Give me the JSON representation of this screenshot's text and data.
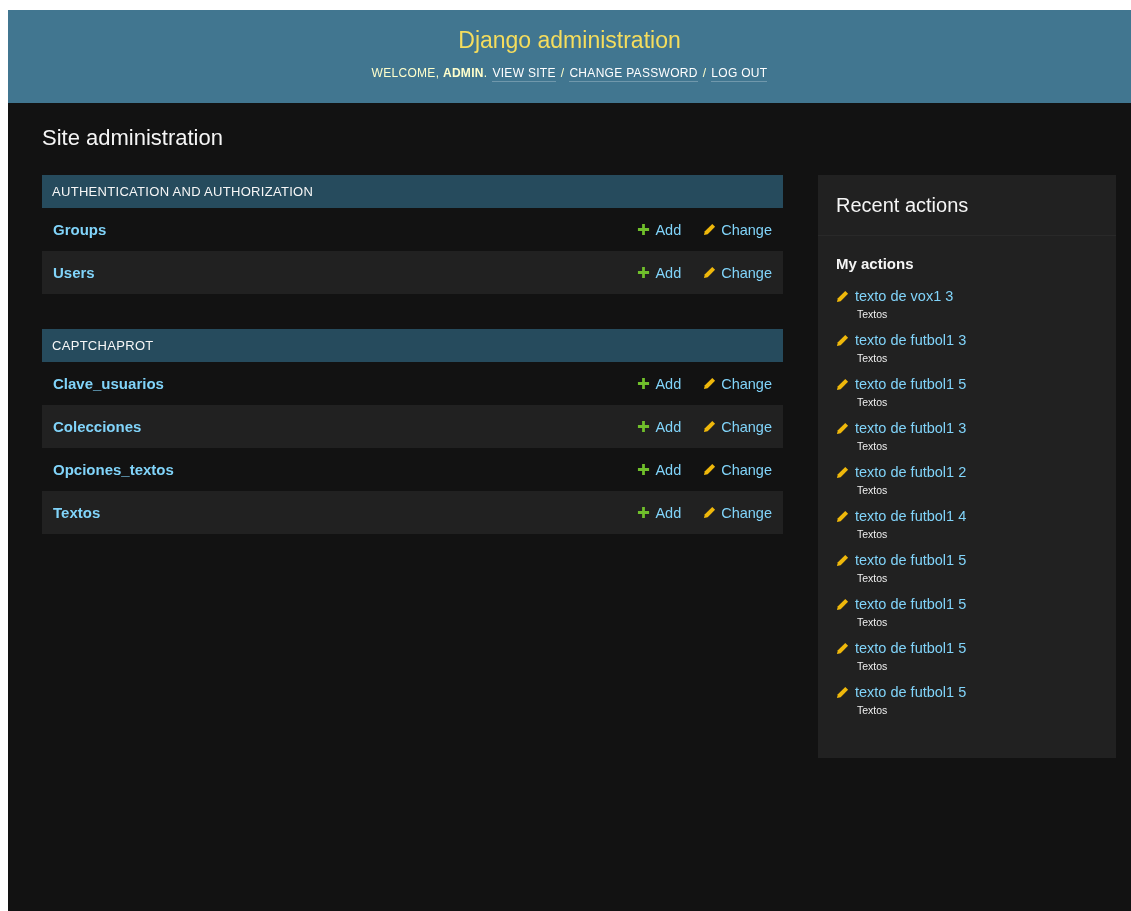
{
  "header": {
    "title": "Django administration",
    "welcome": "WELCOME, **ADMIN**.",
    "separator": "/",
    "links": [
      "VIEW SITE",
      "CHANGE PASSWORD",
      "LOG OUT"
    ]
  },
  "page_title": "Site administration",
  "modules": [
    {
      "caption": "AUTHENTICATION AND AUTHORIZATION",
      "rows": [
        {
          "name": "Groups",
          "add": "Add",
          "change": "Change"
        },
        {
          "name": "Users",
          "add": "Add",
          "change": "Change"
        }
      ]
    },
    {
      "caption": "CAPTCHAPROT",
      "rows": [
        {
          "name": "Clave_usuarios",
          "add": "Add",
          "change": "Change"
        },
        {
          "name": "Colecciones",
          "add": "Add",
          "change": "Change"
        },
        {
          "name": "Opciones_textos",
          "add": "Add",
          "change": "Change"
        },
        {
          "name": "Textos",
          "add": "Add",
          "change": "Change"
        }
      ]
    }
  ],
  "recent_actions": {
    "title": "Recent actions",
    "subtitle": "My actions",
    "items": [
      {
        "kind": "change",
        "label": "texto de vox1 3",
        "model": "Textos"
      },
      {
        "kind": "change",
        "label": "texto de futbol1 3",
        "model": "Textos"
      },
      {
        "kind": "change",
        "label": "texto de futbol1 5",
        "model": "Textos"
      },
      {
        "kind": "change",
        "label": "texto de futbol1 3",
        "model": "Textos"
      },
      {
        "kind": "change",
        "label": "texto de futbol1 2",
        "model": "Textos"
      },
      {
        "kind": "change",
        "label": "texto de futbol1 4",
        "model": "Textos"
      },
      {
        "kind": "change",
        "label": "texto de futbol1 5",
        "model": "Textos"
      },
      {
        "kind": "change",
        "label": "texto de futbol1 5",
        "model": "Textos"
      },
      {
        "kind": "change",
        "label": "texto de futbol1 5",
        "model": "Textos"
      },
      {
        "kind": "change",
        "label": "texto de futbol1 5",
        "model": "Textos"
      }
    ]
  }
}
